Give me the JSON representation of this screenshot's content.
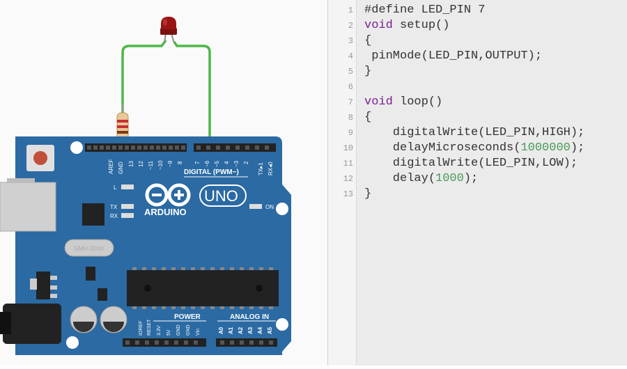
{
  "board": {
    "brand": "ARDUINO",
    "model": "UNO",
    "digital_header": "DIGITAL (PWM~)",
    "power_header": "POWER",
    "analog_header": "ANALOG IN",
    "on_label": "ON",
    "led_l": "L",
    "led_tx": "TX",
    "led_rx": "RX",
    "crystal": "SMH 0000",
    "digital_pins": [
      "AREF",
      "GND",
      "13",
      "12",
      "~11",
      "~10",
      "~9",
      "8",
      "7",
      "~6",
      "~5",
      "4",
      "~3",
      "2",
      "TX▸1",
      "RX◂0"
    ],
    "power_pins": [
      "IOREF",
      "RESET",
      "3.3V",
      "5V",
      "GND",
      "GND",
      "Vin"
    ],
    "analog_pins": [
      "A0",
      "A1",
      "A2",
      "A3",
      "A4",
      "A5"
    ]
  },
  "code_editor": {
    "line_numbers": [
      "1",
      "2",
      "3",
      "4",
      "5",
      "6",
      "7",
      "8",
      "9",
      "10",
      "11",
      "12",
      "13"
    ],
    "lines": [
      {
        "prefix": "#define LED_PIN 7",
        "kw": "",
        "mid": "",
        "num": "",
        "suffix": ""
      },
      {
        "prefix": "",
        "kw": "void",
        "mid": " setup()",
        "num": "",
        "suffix": ""
      },
      {
        "prefix": "{",
        "kw": "",
        "mid": "",
        "num": "",
        "suffix": ""
      },
      {
        "prefix": " pinMode(LED_PIN,OUTPUT);",
        "kw": "",
        "mid": "",
        "num": "",
        "suffix": ""
      },
      {
        "prefix": "}",
        "kw": "",
        "mid": "",
        "num": "",
        "suffix": ""
      },
      {
        "prefix": "",
        "kw": "",
        "mid": "",
        "num": "",
        "suffix": ""
      },
      {
        "prefix": "",
        "kw": "void",
        "mid": " loop()",
        "num": "",
        "suffix": ""
      },
      {
        "prefix": "{",
        "kw": "",
        "mid": "",
        "num": "",
        "suffix": ""
      },
      {
        "prefix": "    digitalWrite(LED_PIN,HIGH);",
        "kw": "",
        "mid": "",
        "num": "",
        "suffix": ""
      },
      {
        "prefix": "    delayMicroseconds(",
        "kw": "",
        "mid": "",
        "num": "1000000",
        "suffix": ");"
      },
      {
        "prefix": "    digitalWrite(LED_PIN,LOW);",
        "kw": "",
        "mid": "",
        "num": "",
        "suffix": ""
      },
      {
        "prefix": "    delay(",
        "kw": "",
        "mid": "",
        "num": "1000",
        "suffix": ");"
      },
      {
        "prefix": "}",
        "kw": "",
        "mid": "",
        "num": "",
        "suffix": ""
      }
    ]
  },
  "colors": {
    "board": "#2b6aa3",
    "wire": "#4cb847",
    "led": "#9a1414",
    "keyword": "#7a1f8f",
    "number": "#4a9a5a"
  }
}
